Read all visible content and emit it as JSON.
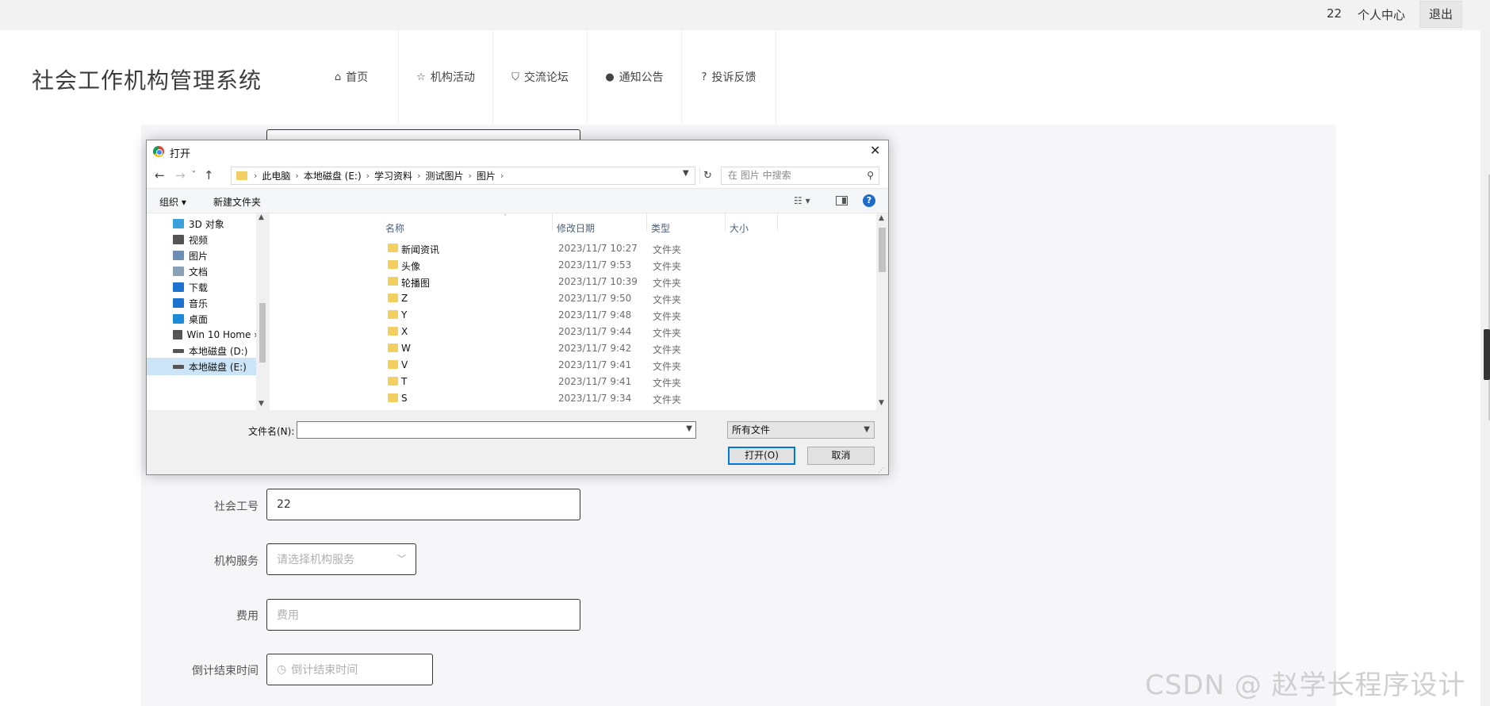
{
  "topbar": {
    "user": "22",
    "personal_center": "个人中心",
    "logout": "退出"
  },
  "site": {
    "title": "社会工作机构管理系统"
  },
  "nav": [
    {
      "icon": "⌂",
      "label": "首页"
    },
    {
      "icon": "☆",
      "label": "机构活动"
    },
    {
      "icon": "⛉",
      "label": "交流论坛"
    },
    {
      "icon": "●",
      "label": "通知公告"
    },
    {
      "icon": "?",
      "label": "投诉反馈"
    }
  ],
  "form": {
    "social_id_label": "社会工号",
    "social_id_value": "22",
    "service_label": "机构服务",
    "service_placeholder": "请选择机构服务",
    "fee_label": "费用",
    "fee_placeholder": "费用",
    "deadline_label": "倒计结束时间",
    "deadline_placeholder": "倒计结束时间"
  },
  "watermark": "CSDN @ 赵学长程序设计",
  "dialog": {
    "title": "打开",
    "breadcrumbs": [
      "此电脑",
      "本地磁盘 (E:)",
      "学习资料",
      "测试图片",
      "图片"
    ],
    "search_placeholder": "在 图片 中搜索",
    "toolbar": {
      "organize": "组织 ▾",
      "new_folder": "新建文件夹"
    },
    "tree": [
      {
        "label": "3D 对象",
        "color": "#3aa0dc"
      },
      {
        "label": "视频",
        "color": "#555555"
      },
      {
        "label": "图片",
        "color": "#6e8fb3"
      },
      {
        "label": "文档",
        "color": "#8aa0b5"
      },
      {
        "label": "下载",
        "color": "#1e72d0"
      },
      {
        "label": "音乐",
        "color": "#1e72d0"
      },
      {
        "label": "桌面",
        "color": "#1e8bd8"
      },
      {
        "label": "Win 10 Home ›",
        "color": "#555555"
      },
      {
        "label": "本地磁盘 (D:)",
        "color": "#555555"
      },
      {
        "label": "本地磁盘 (E:)",
        "color": "#555555",
        "selected": true
      }
    ],
    "columns": {
      "name": "名称",
      "date": "修改日期",
      "type": "类型",
      "size": "大小"
    },
    "files": [
      {
        "name": "新闻资讯",
        "date": "2023/11/7 10:27",
        "type": "文件夹"
      },
      {
        "name": "头像",
        "date": "2023/11/7 9:53",
        "type": "文件夹"
      },
      {
        "name": "轮播图",
        "date": "2023/11/7 10:39",
        "type": "文件夹"
      },
      {
        "name": "Z",
        "date": "2023/11/7 9:50",
        "type": "文件夹"
      },
      {
        "name": "Y",
        "date": "2023/11/7 9:48",
        "type": "文件夹"
      },
      {
        "name": "X",
        "date": "2023/11/7 9:44",
        "type": "文件夹"
      },
      {
        "name": "W",
        "date": "2023/11/7 9:42",
        "type": "文件夹"
      },
      {
        "name": "V",
        "date": "2023/11/7 9:41",
        "type": "文件夹"
      },
      {
        "name": "T",
        "date": "2023/11/7 9:41",
        "type": "文件夹"
      },
      {
        "name": "S",
        "date": "2023/11/7 9:34",
        "type": "文件夹"
      }
    ],
    "filename_label": "文件名(N):",
    "filename_value": "",
    "filetype": "所有文件",
    "open_label": "打开(O)",
    "cancel_label": "取消"
  }
}
